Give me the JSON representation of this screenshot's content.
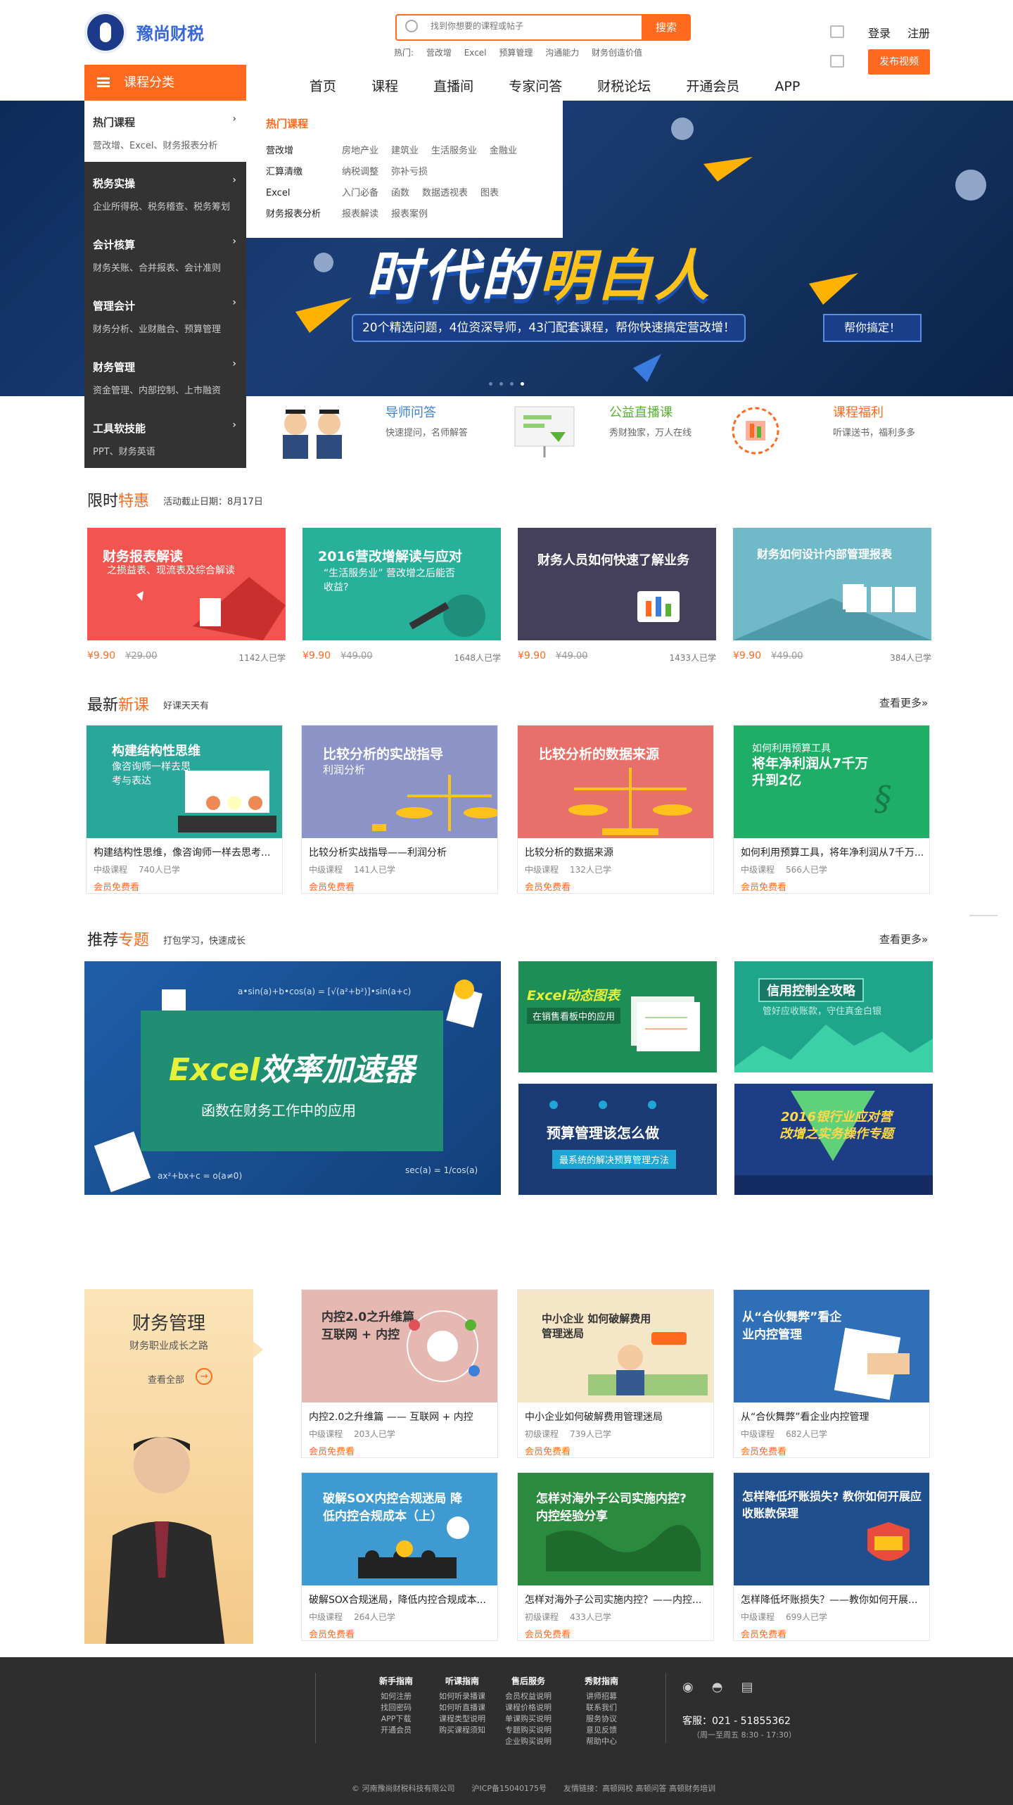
{
  "header": {
    "logo_text": "豫尚财税",
    "search_placeholder": "找到你想要的课程或帖子",
    "search_button": "搜索",
    "hot_label": "热门:",
    "hot_terms": [
      "营改增",
      "Excel",
      "预算管理",
      "沟通能力",
      "财务创造价值"
    ],
    "login": "登录",
    "register": "注册",
    "publish": "发布视频"
  },
  "category_menu": {
    "label": "课程分类",
    "items": [
      {
        "title": "热门课程",
        "sub": "营改增、Excel、财务报表分析"
      },
      {
        "title": "税务实操",
        "sub": "企业所得税、税务稽查、税务筹划"
      },
      {
        "title": "会计核算",
        "sub": "财务关账、合并报表、会计准则"
      },
      {
        "title": "管理会计",
        "sub": "财务分析、业财融合、预算管理"
      },
      {
        "title": "财务管理",
        "sub": "资金管理、内部控制、上市融资"
      },
      {
        "title": "工具软技能",
        "sub": "PPT、财务英语"
      }
    ],
    "panel": {
      "heading": "热门课程",
      "rows": [
        {
          "key": "营改增",
          "values": [
            "房地产业",
            "建筑业",
            "生活服务业",
            "金融业"
          ]
        },
        {
          "key": "汇算清缴",
          "values": [
            "纳税调整",
            "弥补亏损"
          ]
        },
        {
          "key": "Excel",
          "values": [
            "入门必备",
            "函数",
            "数据透视表",
            "图表"
          ]
        },
        {
          "key": "财务报表分析",
          "values": [
            "报表解读",
            "报表案例"
          ]
        }
      ]
    }
  },
  "nav": [
    "首页",
    "课程",
    "直播间",
    "专家问答",
    "财税论坛",
    "开通会员",
    "APP"
  ],
  "banner": {
    "title_a": "时代的",
    "title_b": "明白人",
    "subtitle": "20个精选问题，4位资深导师，43门配套课程，帮你快速搞定营改增！",
    "cta": "帮你搞定！"
  },
  "features": [
    {
      "title": "导师问答",
      "desc": "快速提问，名师解答",
      "color": "#3b7fd9"
    },
    {
      "title": "公益直播课",
      "desc": "秀财独家，万人在线",
      "color": "#58b234"
    },
    {
      "title": "课程福利",
      "desc": "听课送书，福利多多",
      "color": "#ff6a1f"
    }
  ],
  "limited": {
    "title_a": "限时",
    "title_b": "特惠",
    "note": "活动截止日期：8月17日",
    "cards": [
      {
        "title": "财务报表解读",
        "sub": "之损益表、现流表及综合解读",
        "price": "¥9.90",
        "old": "¥29.00",
        "learners": "1142人已学",
        "bg": "#f25550"
      },
      {
        "title": "2016营改增解读与应对",
        "sub": "“生活服务业” 营改增之后能否收益?",
        "price": "¥9.90",
        "old": "¥49.00",
        "learners": "1648人已学",
        "bg": "#27b09a"
      },
      {
        "title": "财务人员如何快速了解业务",
        "sub": "",
        "price": "¥9.90",
        "old": "¥49.00",
        "learners": "1433人已学",
        "bg": "#44405c"
      },
      {
        "title": "财务如何设计内部管理报表",
        "sub": "",
        "price": "¥9.90",
        "old": "¥49.00",
        "learners": "384人已学",
        "bg": "#6fb9c8"
      }
    ]
  },
  "new_courses": {
    "title_a": "最新",
    "title_b": "新课",
    "note": "好课天天有",
    "more": "查看更多»",
    "cards": [
      {
        "thumb_title": "构建结构性思维",
        "thumb_sub": "像咨询师一样去思考与表达",
        "title": "构建结构性思维，像咨询师一样去思考...",
        "level": "中级课程",
        "learners": "740人已学",
        "tag": "会员免费看",
        "bg": "#2aa79b"
      },
      {
        "thumb_title": "比较分析的实战指导",
        "thumb_sub": "利润分析",
        "title": "比较分析实战指导——利润分析",
        "level": "中级课程",
        "learners": "141人已学",
        "tag": "会员免费看",
        "bg": "#8b93c7"
      },
      {
        "thumb_title": "比较分析的数据来源",
        "thumb_sub": "",
        "title": "比较分析的数据来源",
        "level": "中级课程",
        "learners": "132人已学",
        "tag": "会员免费看",
        "bg": "#e8706a"
      },
      {
        "thumb_title": "将年净利润从7千万升到2亿",
        "thumb_sub": "如何利用预算工具",
        "title": "如何利用预算工具，将年净利润从7千万...",
        "level": "中级课程",
        "learners": "566人已学",
        "tag": "会员免费看",
        "bg": "#1fae66"
      }
    ]
  },
  "topics": {
    "title_a": "推荐",
    "title_b": "专题",
    "note": "打包学习，快速成长",
    "more": "查看更多»",
    "big": {
      "title_a": "Excel",
      "title_b": "效率加速器",
      "sub": "函数在财务工作中的应用",
      "formula1": "a•sin(a)+b•cos(a) = [√(a²+b²)]•sin(a+c)",
      "formula2": "ax²+bx+c = o(a≠0)",
      "formula3": "sec(a) = 1/cos(a)"
    },
    "small": [
      {
        "title": "Excel动态图表",
        "sub": "在销售看板中的应用",
        "bg": "#1e8e57"
      },
      {
        "title": "信用控制全攻略",
        "sub": "管好应收账款，守住真金白银",
        "bg": "#1fa58a"
      },
      {
        "title": "预算管理该怎么做",
        "sub": "最系统的解决预算管理方法",
        "bg": "#1c3a73"
      },
      {
        "title": "2016银行业应对营改增之实务操作专题",
        "sub": "",
        "bg": "#1d3d86"
      }
    ]
  },
  "finance_mgmt": {
    "title": "财务管理",
    "sub": "财务职业成长之路",
    "view_all": "查看全部",
    "cards": [
      {
        "thumb_title": "内控2.0之升维篇 互联网 + 内控",
        "title": "内控2.0之升维篇 —— 互联网 + 内控",
        "level": "中级课程",
        "learners": "203人已学",
        "tag": "会员免费看",
        "bg": "#e6b8b2"
      },
      {
        "thumb_title": "中小企业 如何破解费用管理迷局",
        "title": "中小企业如何破解费用管理迷局",
        "level": "初级课程",
        "learners": "739人已学",
        "tag": "会员免费看",
        "bg": "#f6e6c8"
      },
      {
        "thumb_title": "从“合伙舞弊”看企业内控管理",
        "title": "从“合伙舞弊”看企业内控管理",
        "level": "中级课程",
        "learners": "682人已学",
        "tag": "会员免费看",
        "bg": "#2f6fb8"
      },
      {
        "thumb_title": "破解SOX内控合规迷局 降低内控合规成本（上）",
        "title": "破解SOX合规迷局，降低内控合规成本...",
        "level": "中级课程",
        "learners": "264人已学",
        "tag": "会员免费看",
        "bg": "#3f9ad2"
      },
      {
        "thumb_title": "怎样对海外子公司实施内控? 内控经验分享",
        "title": "怎样对海外子公司实施内控？——内控...",
        "level": "初级课程",
        "learners": "433人已学",
        "tag": "会员免费看",
        "bg": "#2a8a3e"
      },
      {
        "thumb_title": "怎样降低坏账损失? 教你如何开展应收账款保理",
        "title": "怎样降低坏账损失？——教你如何开展...",
        "level": "中级课程",
        "learners": "699人已学",
        "tag": "会员免费看",
        "bg": "#1f4f8e"
      }
    ]
  },
  "footer": {
    "cols": [
      {
        "head": "新手指南",
        "items": [
          "如何注册",
          "找回密码",
          "APP下载",
          "开通会员"
        ]
      },
      {
        "head": "听课指南",
        "items": [
          "如何听录播课",
          "如何听直播课",
          "课程类型说明",
          "购买课程须知"
        ]
      },
      {
        "head": "售后服务",
        "items": [
          "会员权益说明",
          "课程价格说明",
          "单课购买说明",
          "专题购买说明",
          "企业购买说明"
        ]
      },
      {
        "head": "秀财指南",
        "items": [
          "讲师招募",
          "联系我们",
          "服务协议",
          "意见反馈",
          "帮助中心"
        ]
      }
    ],
    "tel": "客服：021 - 51855362",
    "tel_note": "（周一至周五  8:30 - 17:30）",
    "copyright": [
      "© 河南豫尚财税科技有限公司",
      "沪ICP备15040175号",
      "友情链接：高顿网校  高顿问答  高顿财务培训"
    ]
  }
}
